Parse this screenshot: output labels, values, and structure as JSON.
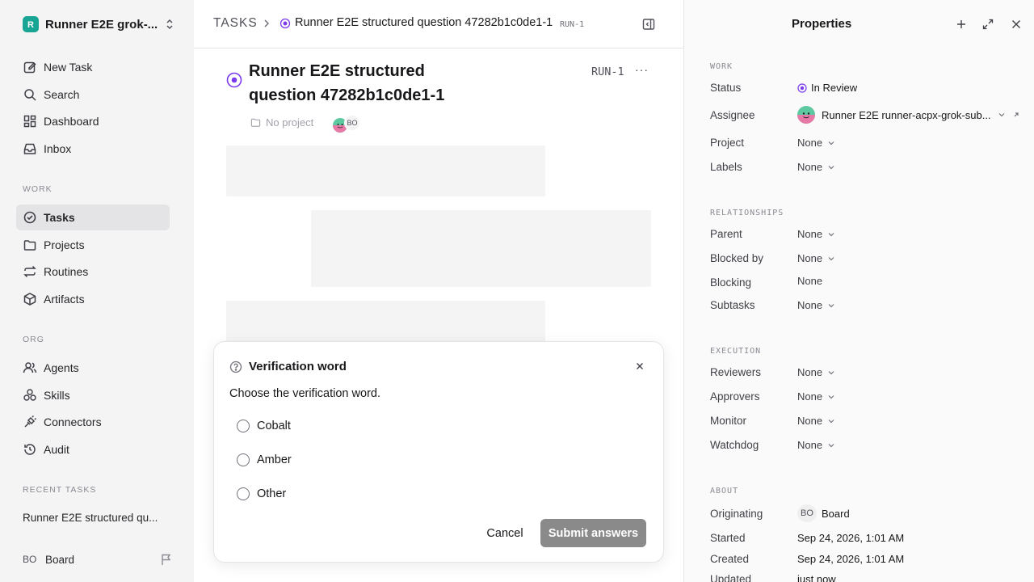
{
  "sidebar": {
    "workspace": "Runner E2E grok-...",
    "workspace_initial": "R",
    "nav_top": [
      {
        "label": "New Task",
        "icon": "edit-icon"
      },
      {
        "label": "Search",
        "icon": "search-icon"
      },
      {
        "label": "Dashboard",
        "icon": "dashboard-icon"
      },
      {
        "label": "Inbox",
        "icon": "inbox-icon"
      }
    ],
    "work_label": "WORK",
    "work_items": [
      {
        "label": "Tasks",
        "icon": "check-circle-icon",
        "active": true
      },
      {
        "label": "Projects",
        "icon": "folder-icon"
      },
      {
        "label": "Routines",
        "icon": "repeat-icon"
      },
      {
        "label": "Artifacts",
        "icon": "box-icon"
      }
    ],
    "org_label": "ORG",
    "org_items": [
      {
        "label": "Agents",
        "icon": "users-icon"
      },
      {
        "label": "Skills",
        "icon": "skills-icon"
      },
      {
        "label": "Connectors",
        "icon": "plug-icon"
      },
      {
        "label": "Audit",
        "icon": "history-icon"
      }
    ],
    "recent_label": "RECENT TASKS",
    "recent_items": [
      "Runner E2E structured qu..."
    ],
    "user": {
      "badge": "BO",
      "name": "Board"
    }
  },
  "breadcrumb": {
    "root": "TASKS",
    "title": "Runner E2E structured question 47282b1c0de1-1",
    "id": "RUN-1"
  },
  "task": {
    "title": "Runner E2E structured question 47282b1c0de1-1",
    "id": "RUN-1",
    "more": "···",
    "project": "No project",
    "avatar_badge": "BO"
  },
  "dialog": {
    "title": "Verification word",
    "question": "Choose the verification word.",
    "options": [
      "Cobalt",
      "Amber",
      "Other"
    ],
    "cancel": "Cancel",
    "submit": "Submit answers"
  },
  "properties": {
    "title": "Properties",
    "work_label": "WORK",
    "status_label": "Status",
    "status_value": "In Review",
    "assignee_label": "Assignee",
    "assignee_value": "Runner E2E runner-acpx-grok-sub...",
    "project_label": "Project",
    "project_value": "None",
    "labels_label": "Labels",
    "labels_value": "None",
    "relationships_label": "RELATIONSHIPS",
    "parent_label": "Parent",
    "parent_value": "None",
    "blocked_by_label": "Blocked by",
    "blocked_by_value": "None",
    "blocking_label": "Blocking",
    "blocking_value": "None",
    "subtasks_label": "Subtasks",
    "subtasks_value": "None",
    "execution_label": "EXECUTION",
    "reviewers_label": "Reviewers",
    "reviewers_value": "None",
    "approvers_label": "Approvers",
    "approvers_value": "None",
    "monitor_label": "Monitor",
    "monitor_value": "None",
    "watchdog_label": "Watchdog",
    "watchdog_value": "None",
    "about_label": "ABOUT",
    "originating_label": "Originating",
    "originating_badge": "BO",
    "originating_value": "Board",
    "started_label": "Started",
    "started_value": "Sep 24, 2026, 1:01 AM",
    "created_label": "Created",
    "created_value": "Sep 24, 2026, 1:01 AM",
    "updated_label": "Updated",
    "updated_value": "just now"
  },
  "colors": {
    "accent_status": "#7c3aed",
    "workspace_logo": "#18a594",
    "submit_button": "#8a8a8a"
  }
}
